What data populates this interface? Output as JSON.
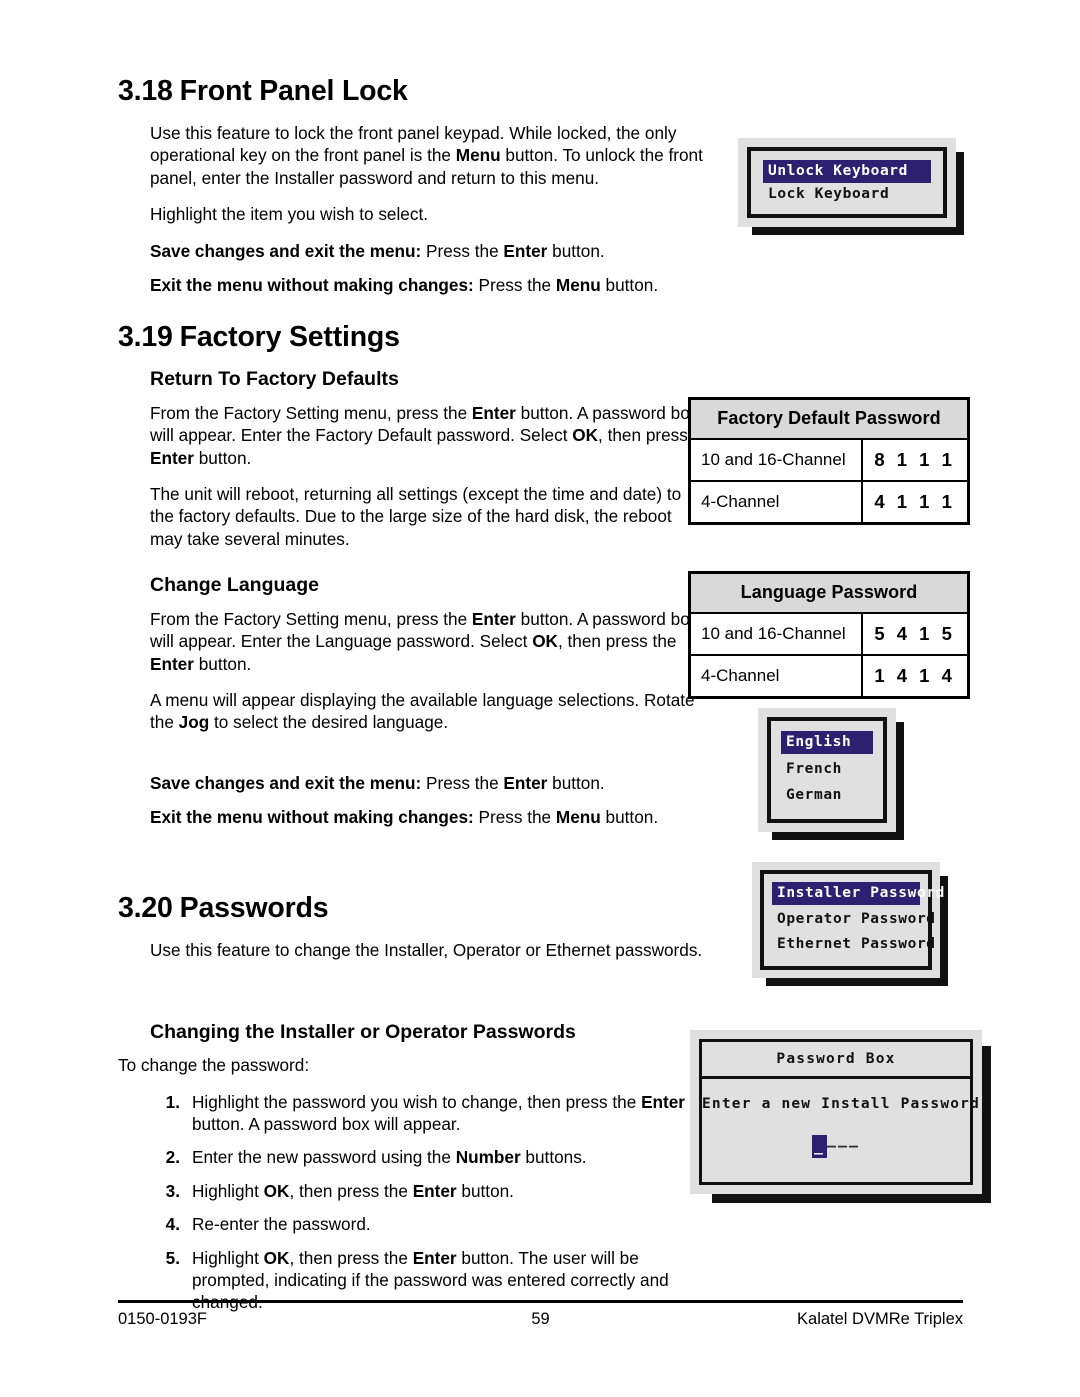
{
  "page": {
    "number": "59",
    "doc_code": "0150-0193F",
    "product": "Kalatel DVMRe Triplex"
  },
  "sections": {
    "front_panel_lock": {
      "number": "3.18",
      "title": "Front Panel Lock",
      "para1_a": "Use this feature to lock the front panel keypad.  While locked, the only operational key on the front panel is the ",
      "para1_b": "Menu",
      "para1_c": " button. To unlock the front panel, enter the Installer password and return to this menu.",
      "para2": "Highlight the item you wish to select.",
      "save_lead": "Save changes and exit the menu:",
      "save_rest_a": " Press the ",
      "save_rest_b": "Enter",
      "save_rest_c": " button.",
      "exit_lead": "Exit the menu without making changes:",
      "exit_rest_a": " Press the ",
      "exit_rest_b": "Menu",
      "exit_rest_c": " button."
    },
    "factory_settings": {
      "number": "3.19",
      "title": "Factory Settings",
      "return_defaults": {
        "heading": "Return To Factory Defaults",
        "p1_a": "From the Factory Setting menu, press the ",
        "p1_b": "Enter",
        "p1_c": " button.  A password box will appear.  Enter the Factory Default password. Select ",
        "p1_d": "OK",
        "p1_e": ", then press the ",
        "p1_f": "Enter",
        "p1_g": " button.",
        "p2": "The unit will reboot, returning all settings (except the time and date) to the factory defaults.  Due to the large size of the hard disk, the reboot may take several minutes."
      },
      "change_language": {
        "heading": "Change Language",
        "p1_a": "From the Factory Setting menu, press the ",
        "p1_b": "Enter",
        "p1_c": " button.  A password box will appear.  Enter the Language password.  Select ",
        "p1_d": "OK",
        "p1_e": ", then press the ",
        "p1_f": "Enter",
        "p1_g": " button.",
        "p2_a": "A menu will appear displaying the available language selections. Rotate the ",
        "p2_b": "Jog",
        "p2_c": " to select the desired language.",
        "save_lead": "Save changes and exit the menu:",
        "save_rest_a": " Press the ",
        "save_rest_b": "Enter",
        "save_rest_c": " button.",
        "exit_lead": "Exit the menu without making changes:",
        "exit_rest_a": " Press the ",
        "exit_rest_b": "Menu",
        "exit_rest_c": " button."
      }
    },
    "passwords": {
      "number": "3.20",
      "title": "Passwords",
      "intro": "Use this feature to change the Installer, Operator or Ethernet passwords.",
      "changing_heading": "Changing the Installer or Operator Passwords",
      "to_change": "To change the password:",
      "steps": [
        {
          "marker": "1.",
          "a": "Highlight the password you wish to change, then press the ",
          "b": "Enter",
          "c": " button.  A password box will appear."
        },
        {
          "marker": "2.",
          "a": "Enter the new password using the ",
          "b": "Number",
          "c": " buttons."
        },
        {
          "marker": "3.",
          "a": "Highlight ",
          "b": "OK",
          "c": ", then press the ",
          "d": "Enter",
          "e": " button."
        },
        {
          "marker": "4.",
          "a": "Re-enter the password.",
          "b": "",
          "c": ""
        },
        {
          "marker": "5.",
          "a": "Highlight ",
          "b": "OK",
          "c": ", then press the ",
          "d": "Enter",
          "e": " button.  The user will be prompted, indicating if the password was entered correctly and changed."
        }
      ]
    }
  },
  "widgets": {
    "keyboard_menu": {
      "items": [
        {
          "label": "Unlock Keyboard",
          "selected": true
        },
        {
          "label": "Lock Keyboard",
          "selected": false
        }
      ]
    },
    "language_menu": {
      "items": [
        {
          "label": "English",
          "selected": true
        },
        {
          "label": "French",
          "selected": false
        },
        {
          "label": "German",
          "selected": false
        }
      ]
    },
    "passwords_menu": {
      "items": [
        {
          "label": "Installer Password",
          "selected": true
        },
        {
          "label": "Operator Password",
          "selected": false
        },
        {
          "label": "Ethernet Password",
          "selected": false
        }
      ]
    },
    "password_box": {
      "title": "Password Box",
      "prompt": "Enter a new Install Password",
      "cursor": "_",
      "remaining": "–––"
    }
  },
  "tables": {
    "factory_default_password": {
      "header": "Factory Default Password",
      "rows": [
        {
          "label": "10 and 16-Channel",
          "code": "8 1 1 1"
        },
        {
          "label": "4-Channel",
          "code": "4 1 1 1"
        }
      ]
    },
    "language_password": {
      "header": "Language Password",
      "rows": [
        {
          "label": "10 and 16-Channel",
          "code": "5 4 1 5"
        },
        {
          "label": "4-Channel",
          "code": "1 4 1 4"
        }
      ]
    }
  },
  "colors": {
    "highlight": "#2e2070",
    "table_header_bg": "#d9d9d9",
    "screen_bg": "#e0e0e0"
  }
}
